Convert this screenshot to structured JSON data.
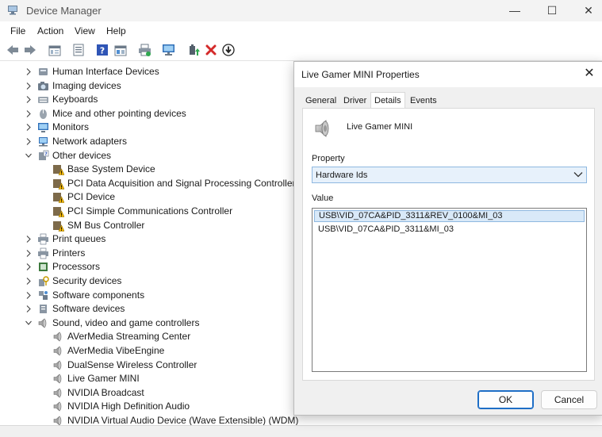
{
  "window": {
    "title": "Device Manager",
    "minimize": "—",
    "maximize": "☐",
    "close": "✕"
  },
  "menu": [
    "File",
    "Action",
    "View",
    "Help"
  ],
  "toolbar": {
    "icons": [
      "back-icon",
      "forward-icon",
      "properties-icon",
      "list-icon",
      "help-icon",
      "view-icon",
      "print-icon",
      "monitor-icon",
      "update-driver-icon",
      "uninstall-icon",
      "download-icon"
    ]
  },
  "tree": [
    {
      "label": "Human Interface Devices",
      "level": 0,
      "expanded": false,
      "icon": "hid-icon"
    },
    {
      "label": "Imaging devices",
      "level": 0,
      "expanded": false,
      "icon": "camera-icon"
    },
    {
      "label": "Keyboards",
      "level": 0,
      "expanded": false,
      "icon": "keyboard-icon"
    },
    {
      "label": "Mice and other pointing devices",
      "level": 0,
      "expanded": false,
      "icon": "mouse-icon"
    },
    {
      "label": "Monitors",
      "level": 0,
      "expanded": false,
      "icon": "monitor-icon"
    },
    {
      "label": "Network adapters",
      "level": 0,
      "expanded": false,
      "icon": "network-icon"
    },
    {
      "label": "Other devices",
      "level": 0,
      "expanded": true,
      "icon": "unknown-device-icon"
    },
    {
      "label": "Base System Device",
      "level": 1,
      "icon": "warning-device-icon"
    },
    {
      "label": "PCI Data Acquisition and Signal Processing Controller",
      "level": 1,
      "icon": "warning-device-icon"
    },
    {
      "label": "PCI Device",
      "level": 1,
      "icon": "warning-device-icon"
    },
    {
      "label": "PCI Simple Communications Controller",
      "level": 1,
      "icon": "warning-device-icon"
    },
    {
      "label": "SM Bus Controller",
      "level": 1,
      "icon": "warning-device-icon"
    },
    {
      "label": "Print queues",
      "level": 0,
      "expanded": false,
      "icon": "printer-icon"
    },
    {
      "label": "Printers",
      "level": 0,
      "expanded": false,
      "icon": "printer-icon"
    },
    {
      "label": "Processors",
      "level": 0,
      "expanded": false,
      "icon": "processor-icon"
    },
    {
      "label": "Security devices",
      "level": 0,
      "expanded": false,
      "icon": "security-icon"
    },
    {
      "label": "Software components",
      "level": 0,
      "expanded": false,
      "icon": "component-icon"
    },
    {
      "label": "Software devices",
      "level": 0,
      "expanded": false,
      "icon": "software-device-icon"
    },
    {
      "label": "Sound, video and game controllers",
      "level": 0,
      "expanded": true,
      "icon": "speaker-icon"
    },
    {
      "label": "AVerMedia Streaming Center",
      "level": 1,
      "icon": "speaker-icon"
    },
    {
      "label": "AVerMedia VibeEngine",
      "level": 1,
      "icon": "speaker-icon"
    },
    {
      "label": "DualSense Wireless Controller",
      "level": 1,
      "icon": "speaker-icon"
    },
    {
      "label": "Live Gamer MINI",
      "level": 1,
      "icon": "speaker-icon"
    },
    {
      "label": "NVIDIA Broadcast",
      "level": 1,
      "icon": "speaker-icon"
    },
    {
      "label": "NVIDIA High Definition Audio",
      "level": 1,
      "icon": "speaker-icon"
    },
    {
      "label": "NVIDIA Virtual Audio Device (Wave Extensible) (WDM)",
      "level": 1,
      "icon": "speaker-icon"
    }
  ],
  "dialog": {
    "title": "Live Gamer MINI Properties",
    "close": "✕",
    "tabs": [
      "General",
      "Driver",
      "Details",
      "Events"
    ],
    "active_tab": "Details",
    "device_name": "Live Gamer MINI",
    "property_label": "Property",
    "property_value": "Hardware Ids",
    "value_label": "Value",
    "values": [
      "USB\\VID_07CA&PID_3311&REV_0100&MI_03",
      "USB\\VID_07CA&PID_3311&MI_03"
    ],
    "ok": "OK",
    "cancel": "Cancel"
  },
  "colors": {
    "accent": "#1e6ec6",
    "selection": "#d9e9f8",
    "warning": "#e0a000",
    "error": "#d42a2a"
  }
}
